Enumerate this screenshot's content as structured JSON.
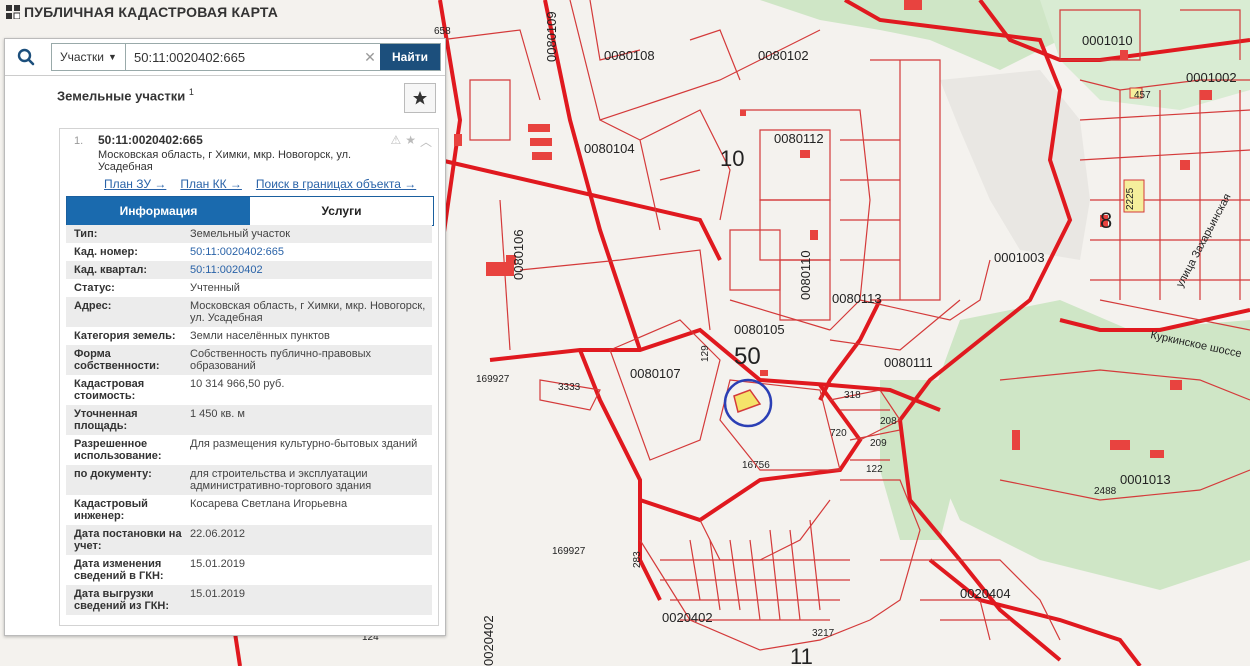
{
  "app": {
    "title": "ПУБЛИЧНАЯ КАДАСТРОВАЯ КАРТА"
  },
  "search": {
    "type_label": "Участки",
    "value": "50:11:0020402:665",
    "button_label": "Найти"
  },
  "section": {
    "title": "Земельные участки",
    "count": "1"
  },
  "result": {
    "index": "1.",
    "cad_number": "50:11:0020402:665",
    "address": "Московская область, г Химки, мкр. Новогорск, ул. Усадебная",
    "links": [
      "План ЗУ →",
      "План КК →",
      "Поиск в границах объекта →"
    ]
  },
  "tabs": [
    {
      "label": "Информация",
      "active": true
    },
    {
      "label": "Услуги",
      "active": false
    }
  ],
  "info_rows": [
    {
      "key": "Тип:",
      "value": "Земельный участок"
    },
    {
      "key": "Кад. номер:",
      "value": "50:11:0020402:665",
      "link": true
    },
    {
      "key": "Кад. квартал:",
      "value": "50:11:0020402",
      "link": true
    },
    {
      "key": "Статус:",
      "value": "Учтенный"
    },
    {
      "key": "Адрес:",
      "value": "Московская область, г Химки, мкр. Новогорск, ул. Усадебная"
    },
    {
      "key": "Категория земель:",
      "value": "Земли населённых пунктов"
    },
    {
      "key": "Форма собственности:",
      "value": "Собственность публично-правовых образований"
    },
    {
      "key": "Кадастровая стоимость:",
      "value": "10 314 966,50 руб."
    },
    {
      "key": "Уточненная площадь:",
      "value": "1 450 кв. м"
    },
    {
      "key": "Разрешенное использование:",
      "value": "Для размещения культурно-бытовых зданий"
    },
    {
      "key": "по документу:",
      "value": "для строительства и эксплуатации административно-торгового здания"
    },
    {
      "key": "Кадастровый инженер:",
      "value": "Косарева Светлана Игорьевна"
    },
    {
      "key": "Дата постановки на учет:",
      "value": "22.06.2012"
    },
    {
      "key": "Дата изменения сведений в ГКН:",
      "value": "15.01.2019"
    },
    {
      "key": "Дата выгрузки сведений из ГКН:",
      "value": "15.01.2019"
    }
  ],
  "map_labels": {
    "q_0080108": "0080108",
    "q_0080102": "0080102",
    "q_0001010": "0001010",
    "q_0001002": "0001002",
    "q_0080104": "0080104",
    "q_0080112": "0080112",
    "q_0080106": "0080106",
    "q_0080110": "0080110",
    "q_0080113": "0080113",
    "q_0001003": "0001003",
    "q_0080105": "0080105",
    "q_0080111": "0080111",
    "q_0080107": "0080107",
    "q_0001013": "0001013",
    "q_0020404": "0020404",
    "q_0020402a": "0020402",
    "q_0020402b": "0020402",
    "q_0080109": "0080109",
    "big_10": "10",
    "big_50": "50",
    "big_8": "8",
    "big_11": "11",
    "p_169927a": "169927",
    "p_169927b": "169927",
    "p_16756": "16756",
    "p_3333": "3333",
    "p_2488": "2488",
    "p_3217": "3217",
    "p_720": "720",
    "p_208": "208",
    "p_318": "318",
    "p_209": "209",
    "p_122": "122",
    "p_124": "124",
    "p_283": "283",
    "p_129": "129",
    "p_457": "457",
    "p_2225": "2225",
    "p_658": "658",
    "street_kurk": "Куркинское шоссе",
    "street_zakh": "улица Захарьинская"
  }
}
